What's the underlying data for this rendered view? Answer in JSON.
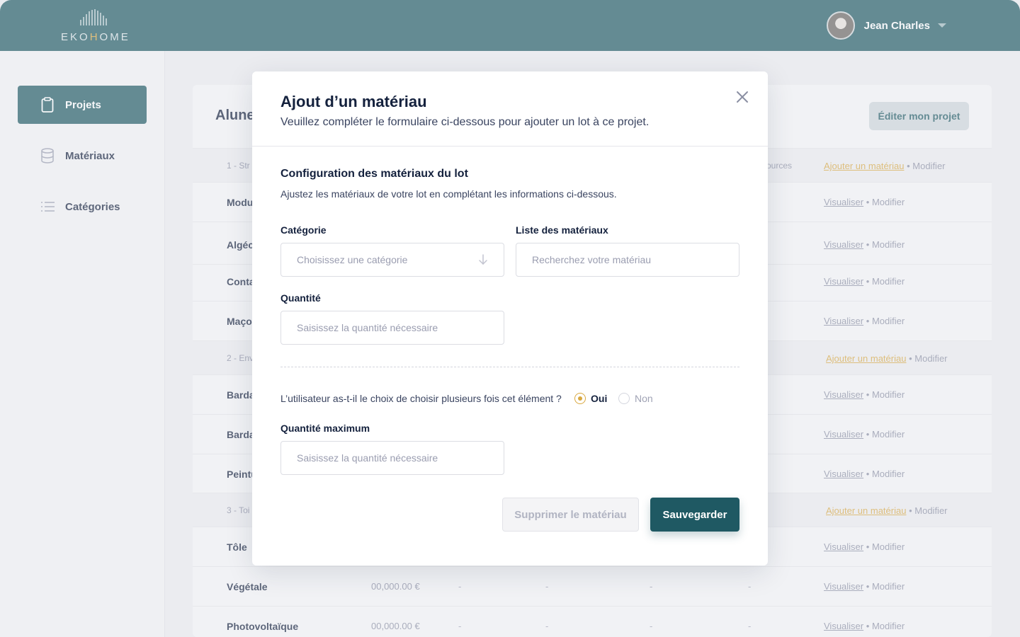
{
  "header": {
    "logo": {
      "pre": "EKO",
      "h": "H",
      "post": "OME"
    },
    "user_name": "Jean Charles"
  },
  "sidebar": {
    "items": [
      {
        "label": "Projets",
        "icon": "clipboard-icon"
      },
      {
        "label": "Matériaux",
        "icon": "database-icon"
      },
      {
        "label": "Catégories",
        "icon": "list-icon"
      }
    ]
  },
  "project": {
    "title": "Alune",
    "edit_label": "Éditer mon projet",
    "sources_label": "ources",
    "groups": [
      {
        "label": "1 - Str",
        "action": "Ajouter un matériau",
        "modify": "Modifier"
      },
      {
        "label": "2 - Env",
        "action": "Ajouter un matériau",
        "modify": "Modifier"
      },
      {
        "label": "3 - Toi",
        "action": "Ajouter un matériau",
        "modify": "Modifier"
      }
    ],
    "rows": [
      {
        "name": "Modu",
        "view": "Visualiser",
        "modify": "Modifier"
      },
      {
        "name": "Algéc",
        "view": "Visualiser",
        "modify": "Modifier"
      },
      {
        "name": "Conta",
        "view": "Visualiser",
        "modify": "Modifier"
      },
      {
        "name": "Maço",
        "view": "Visualiser",
        "modify": "Modifier"
      },
      {
        "name": "Barda",
        "view": "Visualiser",
        "modify": "Modifier"
      },
      {
        "name": "Barda",
        "view": "Visualiser",
        "modify": "Modifier"
      },
      {
        "name": "Peintu",
        "view": "Visualiser",
        "modify": "Modifier"
      },
      {
        "name": "Tôle",
        "view": "Visualiser",
        "modify": "Modifier"
      },
      {
        "name": "Végétale",
        "price": "00,000.00 €",
        "dash": "-",
        "view": "Visualiser",
        "modify": "Modifier"
      },
      {
        "name": "Photovoltaïque",
        "price": "00,000.00 €",
        "dash": "-",
        "view": "Visualiser",
        "modify": "Modifier"
      }
    ],
    "separator": "•"
  },
  "modal": {
    "title": "Ajout d’un matériau",
    "subtitle": "Veuillez compléter le formulaire ci-dessous pour ajouter un lot à ce projet.",
    "section_title": "Configuration des matériaux du lot",
    "section_subtitle": "Ajustez les matériaux de votre lot en complétant les informations ci-dessous.",
    "category_label": "Catégorie",
    "category_placeholder": "Choisissez une catégorie",
    "materials_label": "Liste des matériaux",
    "materials_placeholder": "Recherchez votre matériau",
    "quantity_label": "Quantité",
    "quantity_placeholder": "Saisissez la quantité nécessaire",
    "question": "L’utilisateur as-t-il le choix de choisir plusieurs fois cet élément ?",
    "option_yes": "Oui",
    "option_no": "Non",
    "selected_option": "Oui",
    "max_quantity_label": "Quantité maximum",
    "max_quantity_placeholder": "Saisissez la quantité nécessaire",
    "delete_label": "Supprimer le matériau",
    "save_label": "Sauvegarder"
  },
  "colors": {
    "primary": "#1f5963",
    "accent": "#d9a83f",
    "text": "#14213d"
  }
}
